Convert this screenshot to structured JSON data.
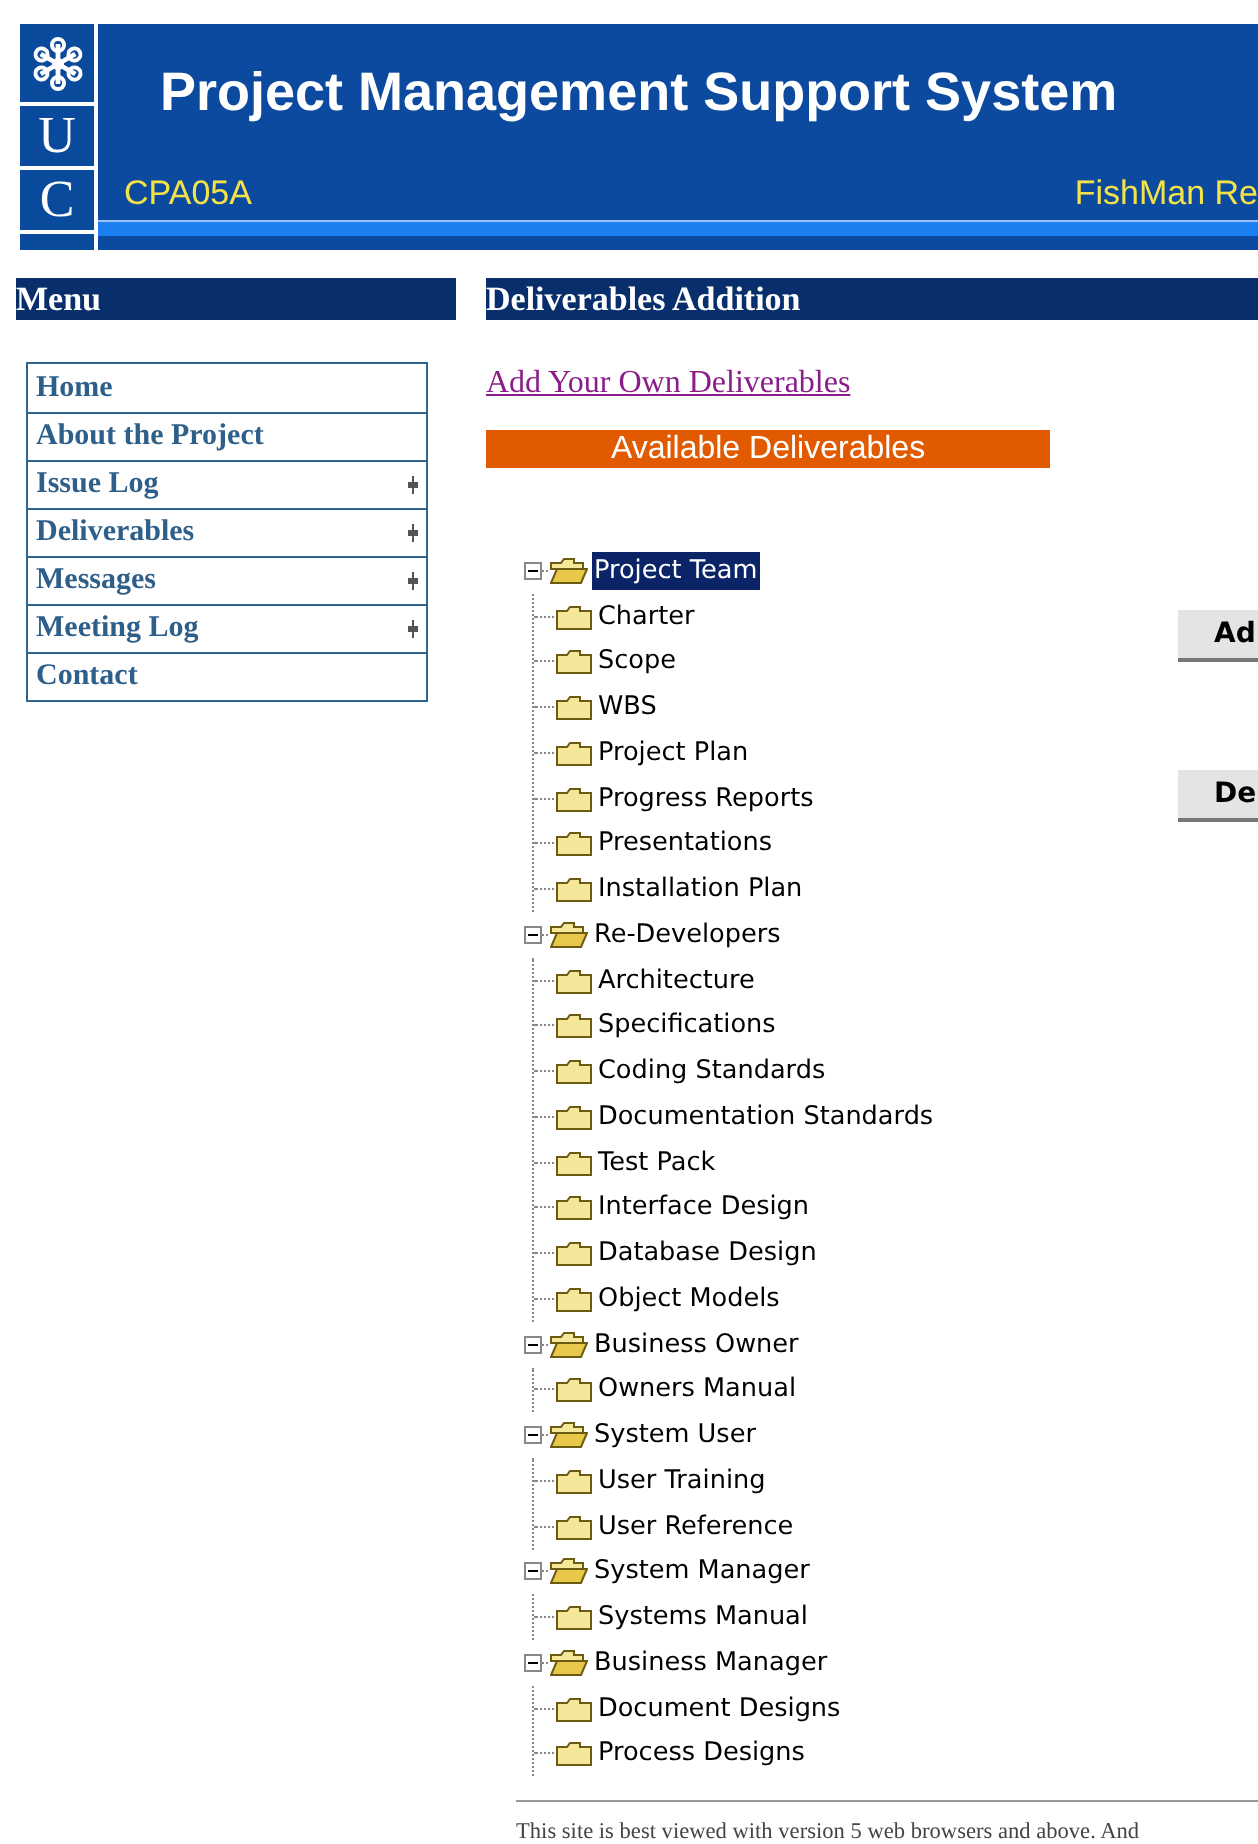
{
  "header": {
    "logo_letters": [
      "U",
      "C"
    ],
    "title": "Project Management Support System",
    "project_code": "CPA05A",
    "team_name": "FishMan Re"
  },
  "menu": {
    "title": "Menu",
    "items": [
      {
        "label": "Home",
        "has_submenu": false
      },
      {
        "label": "About the Project",
        "has_submenu": false
      },
      {
        "label": "Issue Log",
        "has_submenu": true
      },
      {
        "label": "Deliverables",
        "has_submenu": true
      },
      {
        "label": "Messages",
        "has_submenu": true
      },
      {
        "label": "Meeting Log",
        "has_submenu": true
      },
      {
        "label": "Contact",
        "has_submenu": false
      }
    ]
  },
  "content": {
    "title": "Deliverables Addition",
    "link": "Add Your Own Deliverables",
    "banner": "Available Deliverables",
    "tree": [
      {
        "label": "Project Team",
        "expanded": true,
        "selected": true,
        "children": [
          {
            "label": "Charter",
            "selected": false
          },
          {
            "label": "Scope",
            "selected": false
          },
          {
            "label": "WBS",
            "selected": false
          },
          {
            "label": "Project Plan",
            "selected": false
          },
          {
            "label": "Progress Reports",
            "selected": false
          },
          {
            "label": "Presentations",
            "selected": false
          },
          {
            "label": "Installation Plan",
            "selected": false
          }
        ]
      },
      {
        "label": "Re-Developers",
        "expanded": true,
        "selected": false,
        "children": [
          {
            "label": "Architecture",
            "selected": false
          },
          {
            "label": "Specifications",
            "selected": false
          },
          {
            "label": "Coding Standards",
            "selected": false
          },
          {
            "label": "Documentation Standards",
            "selected": false
          },
          {
            "label": "Test Pack",
            "selected": false
          },
          {
            "label": "Interface Design",
            "selected": false
          },
          {
            "label": "Database Design",
            "selected": false
          },
          {
            "label": "Object Models",
            "selected": false
          }
        ]
      },
      {
        "label": "Business Owner",
        "expanded": true,
        "selected": false,
        "children": [
          {
            "label": "Owners Manual",
            "selected": false
          }
        ]
      },
      {
        "label": "System User",
        "expanded": true,
        "selected": false,
        "children": [
          {
            "label": "User Training",
            "selected": false
          },
          {
            "label": "User Reference",
            "selected": false
          }
        ]
      },
      {
        "label": "System Manager",
        "expanded": true,
        "selected": false,
        "children": [
          {
            "label": "Systems Manual",
            "selected": false
          }
        ]
      },
      {
        "label": "Business Manager",
        "expanded": true,
        "selected": false,
        "children": [
          {
            "label": "Document Designs",
            "selected": false
          },
          {
            "label": "Process Designs",
            "selected": false
          }
        ]
      }
    ],
    "buttons": [
      "Ad",
      "De"
    ]
  },
  "footer": "This site is best viewed with version 5 web browsers and above. And"
}
